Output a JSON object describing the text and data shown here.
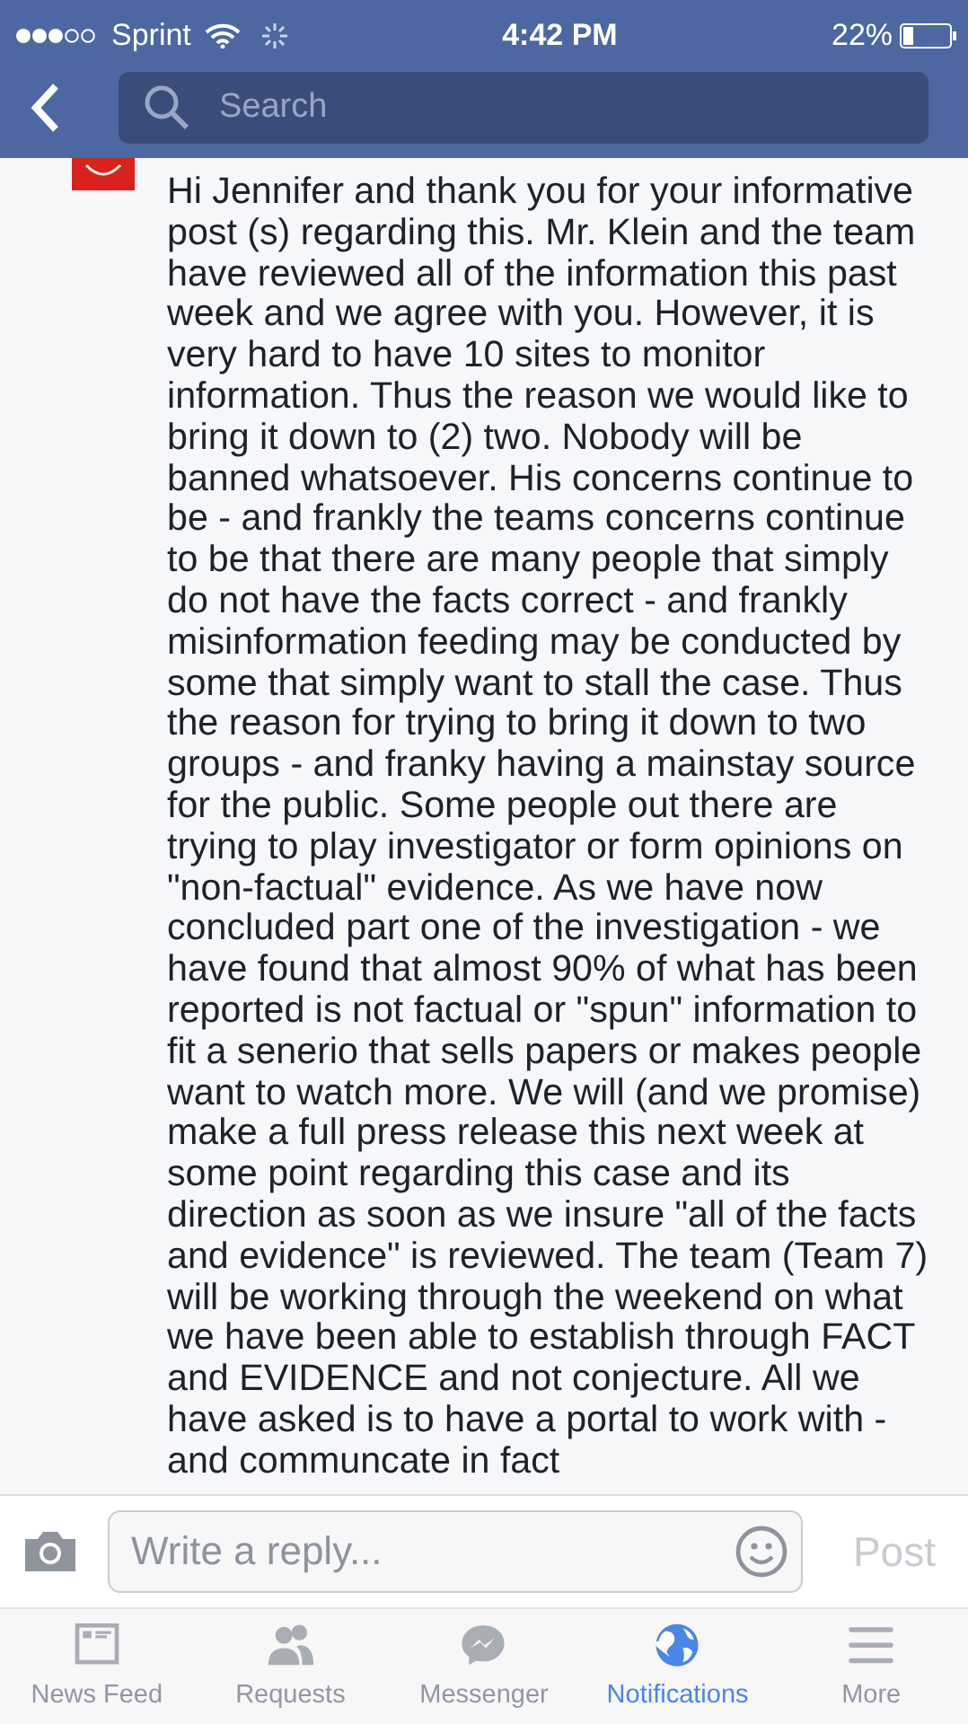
{
  "status_bar": {
    "carrier": "Sprint",
    "time": "4:42 PM",
    "battery": "22%"
  },
  "search": {
    "placeholder": "Search"
  },
  "comment": {
    "text": "Hi Jennifer and thank you for your informative post (s) regarding this. Mr. Klein and the team have reviewed all of the information this past week and we agree with you. However, it is very hard to have 10 sites to monitor information. Thus the reason we would like to bring it down to (2) two. Nobody will be banned whatsoever. His concerns continue to be - and frankly the teams concerns continue to be that there are many people that simply do not have the facts correct - and frankly misinformation feeding may be conducted by some that simply want to stall the case. Thus the reason for trying to bring it down to two groups - and franky having a mainstay source for the public. Some people out there are trying to play investigator or form opinions on \"non-factual\" evidence. As we have now concluded part one of the investigation - we have found that almost 90% of what has been reported is not factual or \"spun\" information to fit a senerio that sells papers or makes people want to watch more. We will (and we promise) make a full press release this next week at some point regarding this case and its direction as soon as we insure \"all of the facts and evidence\" is reviewed. The team (Team 7) will be working through the weekend on what we have been able to establish through FACT and EVIDENCE and not conjecture. All we have asked is to have a portal to work with - and communcate in fact"
  },
  "composer": {
    "placeholder": "Write a reply...",
    "post_button": "Post"
  },
  "tabs": [
    {
      "kind": "feed",
      "label": "News Feed",
      "selected": false
    },
    {
      "kind": "requests",
      "label": "Requests",
      "selected": false
    },
    {
      "kind": "messenger",
      "label": "Messenger",
      "selected": false
    },
    {
      "kind": "notifications",
      "label": "Notifications",
      "selected": true
    },
    {
      "kind": "more",
      "label": "More",
      "selected": false
    }
  ]
}
